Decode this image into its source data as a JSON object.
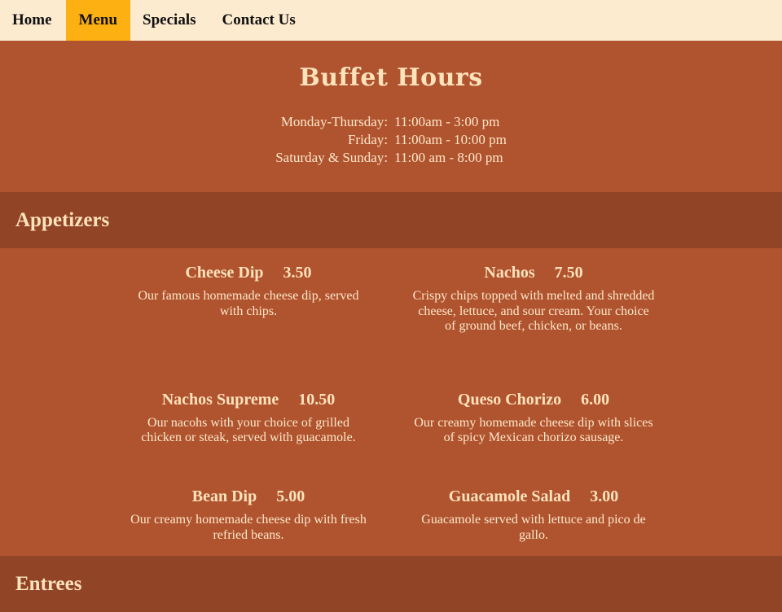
{
  "nav": {
    "items": [
      {
        "label": "Home"
      },
      {
        "label": "Menu"
      },
      {
        "label": "Specials"
      },
      {
        "label": "Contact Us"
      }
    ]
  },
  "hours": {
    "title": "Buffet Hours",
    "rows": [
      {
        "day": "Monday-Thursday:",
        "time": "11:00am - 3:00 pm"
      },
      {
        "day": "Friday:",
        "time": "11:00am - 10:00 pm"
      },
      {
        "day": "Saturday & Sunday:",
        "time": "11:00 am - 8:00 pm"
      }
    ]
  },
  "appetizers": {
    "heading": "Appetizers",
    "items": [
      {
        "name": "Cheese Dip",
        "price": "3.50",
        "desc": "Our famous homemade cheese dip, served with chips."
      },
      {
        "name": "Nachos",
        "price": "7.50",
        "desc": "Crispy chips topped with melted and shredded cheese, lettuce, and sour cream. Your choice of ground beef, chicken, or beans."
      },
      {
        "name": "Nachos Supreme",
        "price": "10.50",
        "desc": "Our nacohs with your choice of grilled chicken or steak, served with guacamole."
      },
      {
        "name": "Queso Chorizo",
        "price": "6.00",
        "desc": "Our creamy homemade cheese dip with slices of spicy Mexican chorizo sausage."
      },
      {
        "name": "Bean Dip",
        "price": "5.00",
        "desc": "Our creamy homemade cheese dip with fresh refried beans."
      },
      {
        "name": "Guacamole Salad",
        "price": "3.00",
        "desc": "Guacamole served with lettuce and pico de gallo."
      }
    ]
  },
  "entrees": {
    "heading": "Entrees"
  },
  "colors": {
    "page_bg": "#b0532f",
    "section_bar": "#924427",
    "nav_bg": "#fdebd0",
    "nav_active": "#fdb011",
    "text": "#fde8c9"
  }
}
